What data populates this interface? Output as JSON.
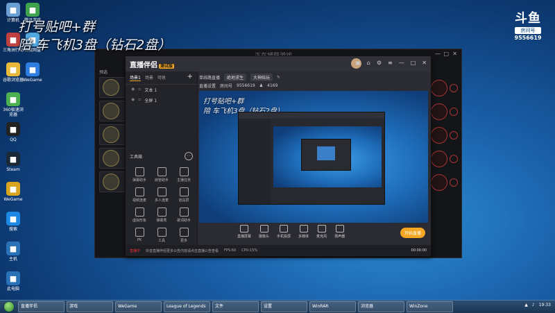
{
  "overlay": {
    "line1": "打号贴吧+群",
    "line2": "陪 车飞机3盘（钻石2盘）"
  },
  "brand": {
    "mark": "斗鱼",
    "tag": "房间号",
    "room_number": "9556619"
  },
  "desktop_icons": [
    {
      "label": "计算机",
      "icon": "computer-icon",
      "color": "#6a9fd4"
    },
    {
      "label": "三角洲行动",
      "icon": "game-icon",
      "color": "#c04040"
    },
    {
      "label": "谷歌浏览器",
      "icon": "chrome-icon",
      "color": "#e8b83a"
    },
    {
      "label": "360极速浏览器",
      "icon": "browser-icon",
      "color": "#4caf50"
    },
    {
      "label": "QQ",
      "icon": "qq-icon",
      "color": "#222222"
    },
    {
      "label": "Steam",
      "icon": "steam-icon",
      "color": "#1b2838"
    },
    {
      "label": "WeGame",
      "icon": "wegame-icon",
      "color": "#d9a51e"
    },
    {
      "label": "搜索",
      "icon": "search-icon",
      "color": "#1e88e5"
    },
    {
      "label": "主机",
      "icon": "monitor-icon",
      "color": "#2a72b8"
    },
    {
      "label": "此电脑",
      "icon": "monitor-icon",
      "color": "#2a72b8"
    }
  ],
  "desktop_icons_col2": [
    {
      "label": "腾讯游戏",
      "icon": "tencent-icon",
      "color": "#3fa34d"
    },
    {
      "label": "百度网盘",
      "icon": "cloud-icon",
      "color": "#53a8e2"
    },
    {
      "label": "WeGame",
      "icon": "wegame-icon",
      "color": "#2f7de1"
    }
  ],
  "bg_window": {
    "title": "正在捕获游戏",
    "side_labels": [
      "预选"
    ]
  },
  "app": {
    "name": "直播伴侣",
    "badge": "测试版",
    "tabs": [
      "场景1",
      "场景",
      "可收"
    ],
    "layers": [
      {
        "label": "文本 1"
      },
      {
        "label": "全屏 1"
      }
    ],
    "tools_title": "工具箱",
    "tools": [
      "弹幕助手",
      "房管助手",
      "主播任务",
      "视频连麦",
      "多人连麦",
      "道具屏",
      "虚拟形象",
      "弹幕秀",
      "歌词助手",
      "PK",
      "工具",
      "更多"
    ],
    "room": {
      "label": "单线路直播",
      "category": "绝地求生",
      "field_label": "直播设置",
      "line": "大神陪玩",
      "room_no_label": "房间号",
      "room_no": "9556619",
      "viewers": "4169"
    },
    "bottom_buttons": [
      "直播屏幕",
      "摄像头",
      "手机投屏",
      "多媒体",
      "麦克风",
      "扬声器"
    ],
    "start_button": "开始直播",
    "status": {
      "live_label": "直播中",
      "notice": "抖音直播伴侣更多公告内容请点击直播公告查看",
      "fps": "FPS:60",
      "bitrate": "CPU:15%",
      "time": "00:00:00"
    }
  },
  "taskbar": {
    "items": [
      "直播伴侣",
      "游戏",
      "WeGame",
      "League of Legends",
      "文件",
      "设置",
      "WinRAR",
      "浏览器",
      "WinZone"
    ],
    "clock": "19:33"
  }
}
